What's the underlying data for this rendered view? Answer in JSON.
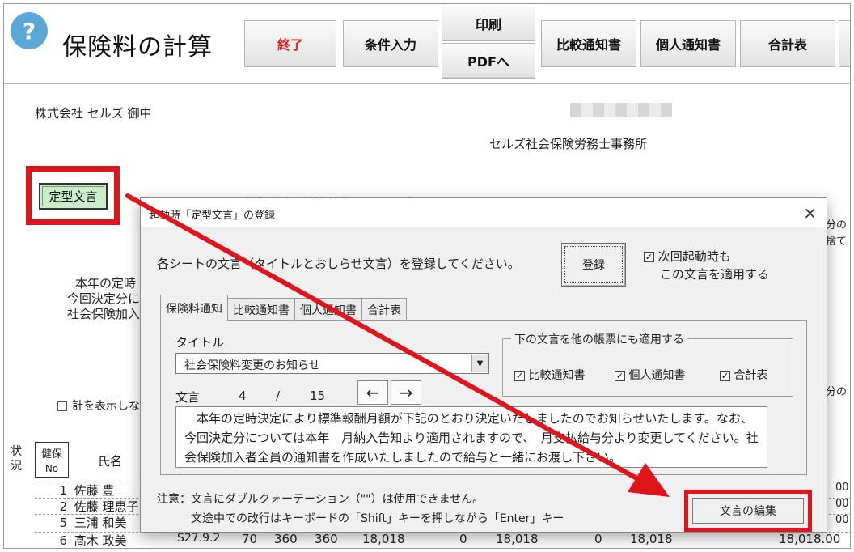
{
  "header": {
    "help_icon": "?",
    "app_title": "保険料の計算",
    "buttons": {
      "exit": "終了",
      "conditions": "条件入力",
      "print": "印刷",
      "pdf": "PDFへ",
      "comparison": "比較通知書",
      "individual": "個人通知書",
      "total": "合計表"
    }
  },
  "doc": {
    "company": "株式会社 セルズ 御中",
    "office": "セルズ社会保険労務士事務所",
    "teikei_button": "定型文言",
    "bg_title_partial": "社会保険料変更のお知らせ",
    "bg_line1": "本年の定時",
    "bg_line2": "今回決定分に",
    "bg_line3": "社会保険加入",
    "right_frag1": "分の",
    "right_frag2": "捨て",
    "right_frag3": "分の",
    "show_total_label": "計を表示しな",
    "table": {
      "col_status": "状況",
      "col_health_top": "健保",
      "col_health_bottom": "No",
      "col_name": "氏名",
      "rows": [
        {
          "no": "1",
          "name": "佐藤 豊",
          "tail": "00"
        },
        {
          "no": "2",
          "name": "佐藤 理恵子",
          "tail": "00"
        },
        {
          "no": "5",
          "name": "三浦 和美",
          "tail": "00"
        },
        {
          "no": "6",
          "name": "髙木 政美",
          "birth": "S27.9.2",
          "c1": "70",
          "c2": "360",
          "c3": "360",
          "c4": "18,018",
          "c5": "0",
          "c6": "18,018",
          "c7": "0",
          "c8": "18,018",
          "c9": "18,018.00"
        }
      ]
    }
  },
  "dialog": {
    "title": "起動時「定型文言」の登録",
    "close": "×",
    "instruction": "各シートの文言（タイトルとおしらせ文言）を登録してください。",
    "register_button": "登録",
    "next_startup_line1": "次回起動時も",
    "next_startup_line2": "この文言を適用する",
    "next_startup_checked": true,
    "tabs": [
      "保険料通知",
      "比較通知書",
      "個人通知書",
      "合計表"
    ],
    "active_tab": 0,
    "title_label": "タイトル",
    "title_value": "社会保険料変更のお知らせ",
    "body_label": "文言",
    "counter_current": "4",
    "counter_sep": "/",
    "counter_total": "15",
    "prev_arrow": "←",
    "next_arrow": "→",
    "body_text": "　本年の定時決定により標準報酬月額が下記のとおり決定いたしましたのでお知らせいたします。なお、今回決定分については本年　月納入告知より適用されますので、　月支払給与分より変更してください。社会保険加入者全員の通知書を作成いたしましたので給与と一緒にお渡し下さい。",
    "apply_group_label": "下の文言を他の帳票にも適用する",
    "apply_options": [
      {
        "label": "比較通知書",
        "checked": true
      },
      {
        "label": "個人通知書",
        "checked": true
      },
      {
        "label": "合計表",
        "checked": true
      }
    ],
    "note_line1": "注意：文言にダブルクォーテーション（\"\"）は使用できません。",
    "note_line2": "　　　文途中での改行はキーボードの「Shift」キーを押しながら「Enter」キー",
    "edit_button": "文言の編集"
  },
  "colors": {
    "highlight_red": "#e0151c",
    "teikei_green": "#c6f0c6",
    "help_blue": "#5aa7d8",
    "exit_red": "#e02020"
  }
}
